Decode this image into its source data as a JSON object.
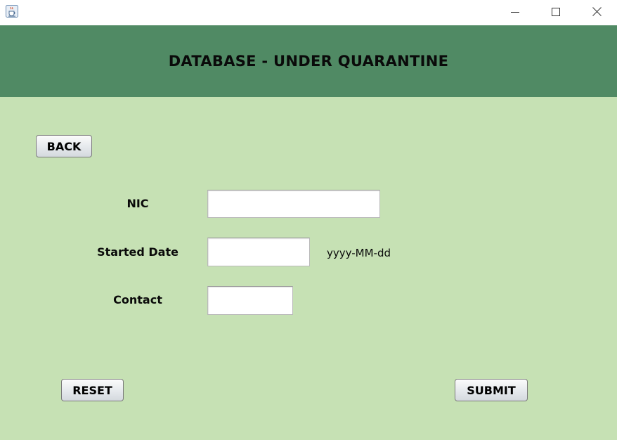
{
  "window": {
    "title": "",
    "app_icon": "java-cup-icon",
    "controls": {
      "minimize_icon": "minimize-icon",
      "maximize_icon": "maximize-icon",
      "close_icon": "close-icon"
    }
  },
  "header": {
    "title": "DATABASE - UNDER QUARANTINE",
    "background_color": "#508a64"
  },
  "content": {
    "background_color": "#c6e1b4"
  },
  "buttons": {
    "back": "BACK",
    "reset": "RESET",
    "submit": "SUBMIT"
  },
  "form": {
    "nic": {
      "label": "NIC",
      "value": ""
    },
    "started_date": {
      "label": "Started Date",
      "value": "",
      "hint": "yyyy-MM-dd"
    },
    "contact": {
      "label": "Contact",
      "value": ""
    }
  }
}
